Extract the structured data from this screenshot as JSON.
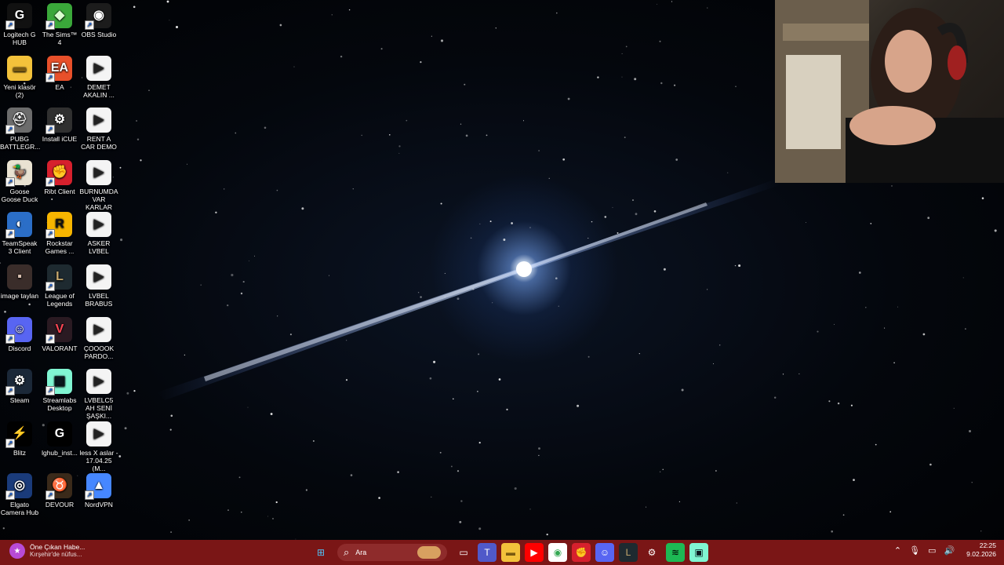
{
  "desktop": {
    "icons": [
      {
        "label": "Logitech G HUB",
        "icon": "logitech-g-icon",
        "bg": "#111111",
        "fg": "#ffffff",
        "glyph": "G",
        "shortcut": true
      },
      {
        "label": "The Sims™ 4",
        "icon": "sims-plumbob-icon",
        "bg": "#3aa83a",
        "fg": "#d9ffd0",
        "glyph": "◆",
        "shortcut": true
      },
      {
        "label": "OBS Studio",
        "icon": "obs-icon",
        "bg": "#1c1c1c",
        "fg": "#ffffff",
        "glyph": "◉",
        "shortcut": true
      },
      {
        "label": "Yeni klasör (2)",
        "icon": "folder-icon",
        "bg": "#f3c23b",
        "fg": "#7a5a10",
        "glyph": "▬",
        "shortcut": false
      },
      {
        "label": "EA",
        "icon": "ea-icon",
        "bg": "#e8502a",
        "fg": "#ffffff",
        "glyph": "EA",
        "shortcut": true
      },
      {
        "label": "DEMET AKALIN ...",
        "icon": "video-file-icon",
        "bg": "#f4f4f4",
        "fg": "#222222",
        "glyph": "▶",
        "shortcut": false
      },
      {
        "label": "PUBG BATTLEGR...",
        "icon": "pubg-icon",
        "bg": "#6c6c6c",
        "fg": "#eeeeee",
        "glyph": "⛑",
        "shortcut": true
      },
      {
        "label": "Install iCUE",
        "icon": "icue-icon",
        "bg": "#303030",
        "fg": "#ffffff",
        "glyph": "⚙",
        "shortcut": true
      },
      {
        "label": "RENT A CAR DEMO",
        "icon": "video-file-icon",
        "bg": "#f4f4f4",
        "fg": "#222222",
        "glyph": "▶",
        "shortcut": false
      },
      {
        "label": "Goose Goose Duck",
        "icon": "goose-icon",
        "bg": "#e9e2d2",
        "fg": "#c04a1a",
        "glyph": "🦆",
        "shortcut": true
      },
      {
        "label": "Riot Client",
        "icon": "riot-icon",
        "bg": "#d6202d",
        "fg": "#ffffff",
        "glyph": "✊",
        "shortcut": true
      },
      {
        "label": "BURNUMDA VAR KARLAR",
        "icon": "video-file-icon",
        "bg": "#f4f4f4",
        "fg": "#222222",
        "glyph": "▶",
        "shortcut": false
      },
      {
        "label": "TeamSpeak 3 Client",
        "icon": "teamspeak-icon",
        "bg": "#2b6ec7",
        "fg": "#ffffff",
        "glyph": "◐",
        "shortcut": true
      },
      {
        "label": "Rockstar Games ...",
        "icon": "rockstar-icon",
        "bg": "#f7b500",
        "fg": "#111111",
        "glyph": "R",
        "shortcut": true
      },
      {
        "label": "ASKER LVBEL",
        "icon": "video-file-icon",
        "bg": "#f4f4f4",
        "fg": "#222222",
        "glyph": "▶",
        "shortcut": false
      },
      {
        "label": "image taylan",
        "icon": "image-file-icon",
        "bg": "#3a2d2a",
        "fg": "#d9c0b0",
        "glyph": "▪",
        "shortcut": false
      },
      {
        "label": "League of Legends",
        "icon": "league-icon",
        "bg": "#1e2a30",
        "fg": "#c8aa6e",
        "glyph": "L",
        "shortcut": true
      },
      {
        "label": "LVBEL BRABUS",
        "icon": "video-file-icon",
        "bg": "#f4f4f4",
        "fg": "#222222",
        "glyph": "▶",
        "shortcut": false
      },
      {
        "label": "Discord",
        "icon": "discord-icon",
        "bg": "#5865f2",
        "fg": "#ffffff",
        "glyph": "☺",
        "shortcut": true
      },
      {
        "label": "VALORANT",
        "icon": "valorant-icon",
        "bg": "#2a1a22",
        "fg": "#ff4655",
        "glyph": "V",
        "shortcut": true
      },
      {
        "label": "ÇOOOOK PARDO...",
        "icon": "video-file-icon",
        "bg": "#f4f4f4",
        "fg": "#222222",
        "glyph": "▶",
        "shortcut": false
      },
      {
        "label": "Steam",
        "icon": "steam-icon",
        "bg": "#1b2838",
        "fg": "#ffffff",
        "glyph": "⚙",
        "shortcut": true
      },
      {
        "label": "Streamlabs Desktop",
        "icon": "streamlabs-icon",
        "bg": "#80f5d2",
        "fg": "#09161d",
        "glyph": "▣",
        "shortcut": true
      },
      {
        "label": "LVBELC5 AH SENİ ŞAŞKI...",
        "icon": "video-file-icon",
        "bg": "#f4f4f4",
        "fg": "#222222",
        "glyph": "▶",
        "shortcut": false
      },
      {
        "label": "Blitz",
        "icon": "blitz-icon",
        "bg": "#000000",
        "fg": "#ff3b4a",
        "glyph": "⚡",
        "shortcut": true
      },
      {
        "label": "lghub_inst...",
        "icon": "logitech-g-icon",
        "bg": "#000000",
        "fg": "#ffffff",
        "glyph": "G",
        "shortcut": false
      },
      {
        "label": "less X aslar - 17.04.25 (M...",
        "icon": "video-file-icon",
        "bg": "#f4f4f4",
        "fg": "#222222",
        "glyph": "▶",
        "shortcut": false
      },
      {
        "label": "Elgato Camera Hub",
        "icon": "elgato-icon",
        "bg": "#1a3b7a",
        "fg": "#ffffff",
        "glyph": "◎",
        "shortcut": true
      },
      {
        "label": "DEVOUR",
        "icon": "devour-icon",
        "bg": "#3a2a1a",
        "fg": "#e0782c",
        "glyph": "♉",
        "shortcut": true
      },
      {
        "label": "NordVPN",
        "icon": "nordvpn-icon",
        "bg": "#4687ff",
        "fg": "#ffffff",
        "glyph": "▲",
        "shortcut": true
      }
    ]
  },
  "taskbar": {
    "news_title": "Öne Çıkan Habe...",
    "news_sub": "Kırşehir'de nüfus...",
    "search_placeholder": "Ara",
    "time": "22:25",
    "date": "9.02.2026",
    "apps": [
      {
        "icon": "windows-start-icon",
        "bg": "transparent",
        "fg": "#4fc3f7",
        "glyph": "⊞"
      },
      {
        "icon": "search-icon",
        "bg": "transparent",
        "fg": "#ffffff",
        "glyph": ""
      },
      {
        "icon": "task-view-icon",
        "bg": "transparent",
        "fg": "#ffffff",
        "glyph": "▭"
      },
      {
        "icon": "teams-icon",
        "bg": "#5059c9",
        "fg": "#ffffff",
        "glyph": "T"
      },
      {
        "icon": "file-explorer-icon",
        "bg": "#f3c23b",
        "fg": "#7a5a10",
        "glyph": "▬"
      },
      {
        "icon": "youtube-icon",
        "bg": "#ff0000",
        "fg": "#ffffff",
        "glyph": "▶"
      },
      {
        "icon": "chrome-icon",
        "bg": "#ffffff",
        "fg": "#34a853",
        "glyph": "◉"
      },
      {
        "icon": "riot-client-icon",
        "bg": "#d6202d",
        "fg": "#ffffff",
        "glyph": "✊"
      },
      {
        "icon": "discord-icon",
        "bg": "#5865f2",
        "fg": "#ffffff",
        "glyph": "☺"
      },
      {
        "icon": "league-icon",
        "bg": "#1e2a30",
        "fg": "#c8aa6e",
        "glyph": "L"
      },
      {
        "icon": "settings-icon",
        "bg": "transparent",
        "fg": "#ffffff",
        "glyph": "⚙"
      },
      {
        "icon": "spotify-icon",
        "bg": "#1db954",
        "fg": "#000000",
        "glyph": "≋"
      },
      {
        "icon": "streamlabs-icon",
        "bg": "#80f5d2",
        "fg": "#09161d",
        "glyph": "▣"
      }
    ],
    "tray": [
      {
        "icon": "chevron-up-icon",
        "glyph": "⌃"
      },
      {
        "icon": "microphone-icon",
        "glyph": "🎙"
      },
      {
        "icon": "display-icon",
        "glyph": "▭"
      },
      {
        "icon": "speaker-icon",
        "glyph": "🔊"
      }
    ]
  }
}
